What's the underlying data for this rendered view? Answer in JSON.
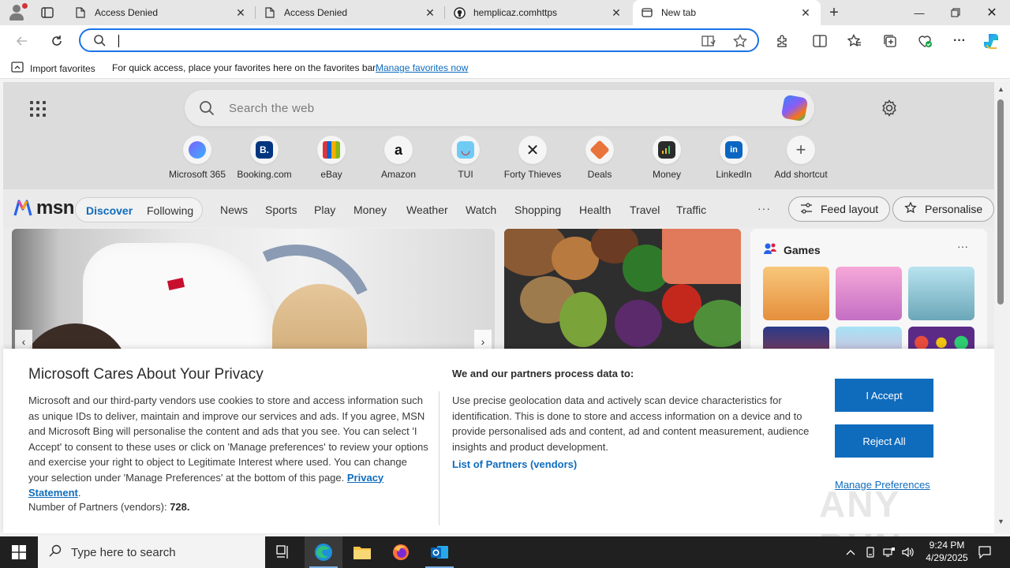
{
  "tabs": [
    {
      "title": "Access Denied",
      "favicon": "page-icon"
    },
    {
      "title": "Access Denied",
      "favicon": "page-icon"
    },
    {
      "title": "hemplicaz.comhttps",
      "favicon": "github-icon"
    },
    {
      "title": "New tab",
      "favicon": "newtab-icon",
      "active": true
    }
  ],
  "address_bar": {
    "value": "",
    "placeholder": ""
  },
  "favorites_bar": {
    "import_label": "Import favorites",
    "message": "For quick access, place your favorites here on the favorites bar.",
    "manage_link": "Manage favorites now"
  },
  "newtab": {
    "search_placeholder": "Search the web",
    "shortcuts": [
      {
        "label": "Microsoft 365",
        "icon": "m365-icon",
        "color": "#7b61ff"
      },
      {
        "label": "Booking.com",
        "icon": "booking-icon",
        "color": "#003580"
      },
      {
        "label": "eBay",
        "icon": "ebay-icon",
        "color": "#e53238"
      },
      {
        "label": "Amazon",
        "icon": "amazon-icon",
        "color": "#111111"
      },
      {
        "label": "TUI",
        "icon": "tui-icon",
        "color": "#70cbf4"
      },
      {
        "label": "Forty Thieves",
        "icon": "swords-icon",
        "color": "#222222"
      },
      {
        "label": "Deals",
        "icon": "deals-icon",
        "color": "#e8743b"
      },
      {
        "label": "Money",
        "icon": "money-icon",
        "color": "#2b2b2b"
      },
      {
        "label": "LinkedIn",
        "icon": "linkedin-icon",
        "color": "#0a66c2"
      },
      {
        "label": "Add shortcut",
        "icon": "plus-icon",
        "color": "#555555"
      }
    ]
  },
  "msn": {
    "logo": "msn",
    "discover": "Discover",
    "following": "Following",
    "nav": [
      "News",
      "Sports",
      "Play",
      "Money",
      "Weather",
      "Watch",
      "Shopping",
      "Health",
      "Travel",
      "Traffic"
    ],
    "more": "···",
    "feed_layout": "Feed layout",
    "personalise": "Personalise",
    "games_title": "Games",
    "games_more": "···"
  },
  "consent": {
    "title": "Microsoft Cares About Your Privacy",
    "body": "Microsoft and our third-party vendors use cookies to store and access information such as unique IDs to deliver, maintain and improve our services and ads. If you agree, MSN and Microsoft Bing will personalise the content and ads that you see. You can select 'I Accept' to consent to these uses or click on 'Manage preferences' to review your options and exercise your right to object to Legitimate Interest where used.  You can change your selection under 'Manage Preferences' at the bottom of this page.",
    "privacy_link": "Privacy Statement",
    "partners_label": "Number of Partners (vendors):",
    "partners_count": "728.",
    "purpose_title": "We and our partners process data to:",
    "purpose_text": "Use precise geolocation data and actively scan device characteristics for identification. This is done to store and access information on a device and to provide personalised ads and content, ad and content measurement, audience insights and product development.",
    "list_link": "List of Partners (vendors)",
    "accept": "I Accept",
    "reject": "Reject All",
    "manage": "Manage Preferences"
  },
  "watermark": "ANY RUN",
  "taskbar": {
    "search_placeholder": "Type here to search",
    "time": "9:24 PM",
    "date": "4/29/2025"
  },
  "colors": {
    "accent": "#0f6cbd",
    "address_focus": "#1a73e8",
    "taskbar": "#202020"
  }
}
